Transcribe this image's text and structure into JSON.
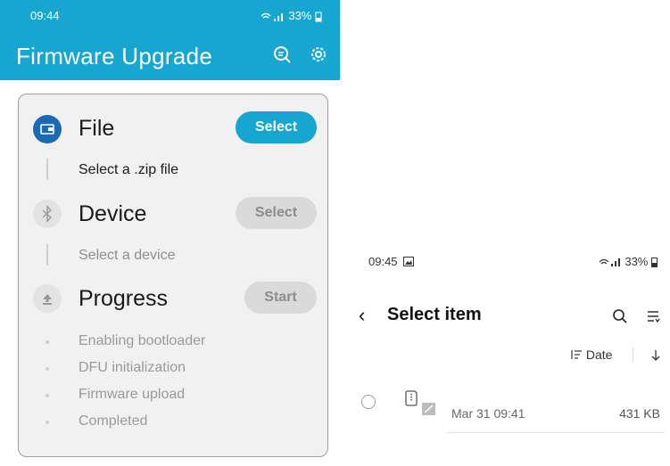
{
  "left": {
    "status": {
      "time": "09:44",
      "battery": "33%"
    },
    "appbar": {
      "title": "Firmware Upgrade",
      "icons": [
        "search-icon",
        "gear-icon"
      ]
    },
    "steps": {
      "file": {
        "title": "File",
        "subtitle": "Select a .zip file",
        "button": "Select"
      },
      "device": {
        "title": "Device",
        "subtitle": "Select a device",
        "button": "Select"
      },
      "progress": {
        "title": "Progress",
        "button": "Start",
        "stages": [
          "Enabling bootloader",
          "DFU initialization",
          "Firmware upload",
          "Completed"
        ]
      }
    },
    "colors": {
      "accent": "#16a6cf",
      "step_active": "#1b6ab5",
      "disabled": "#dadada"
    }
  },
  "right": {
    "status": {
      "time": "09:45",
      "battery": "33%"
    },
    "header": {
      "title": "Select item"
    },
    "sort": {
      "label": "Date"
    },
    "files": [
      {
        "date": "Mar 31 09:41",
        "size": "431 KB"
      }
    ]
  }
}
